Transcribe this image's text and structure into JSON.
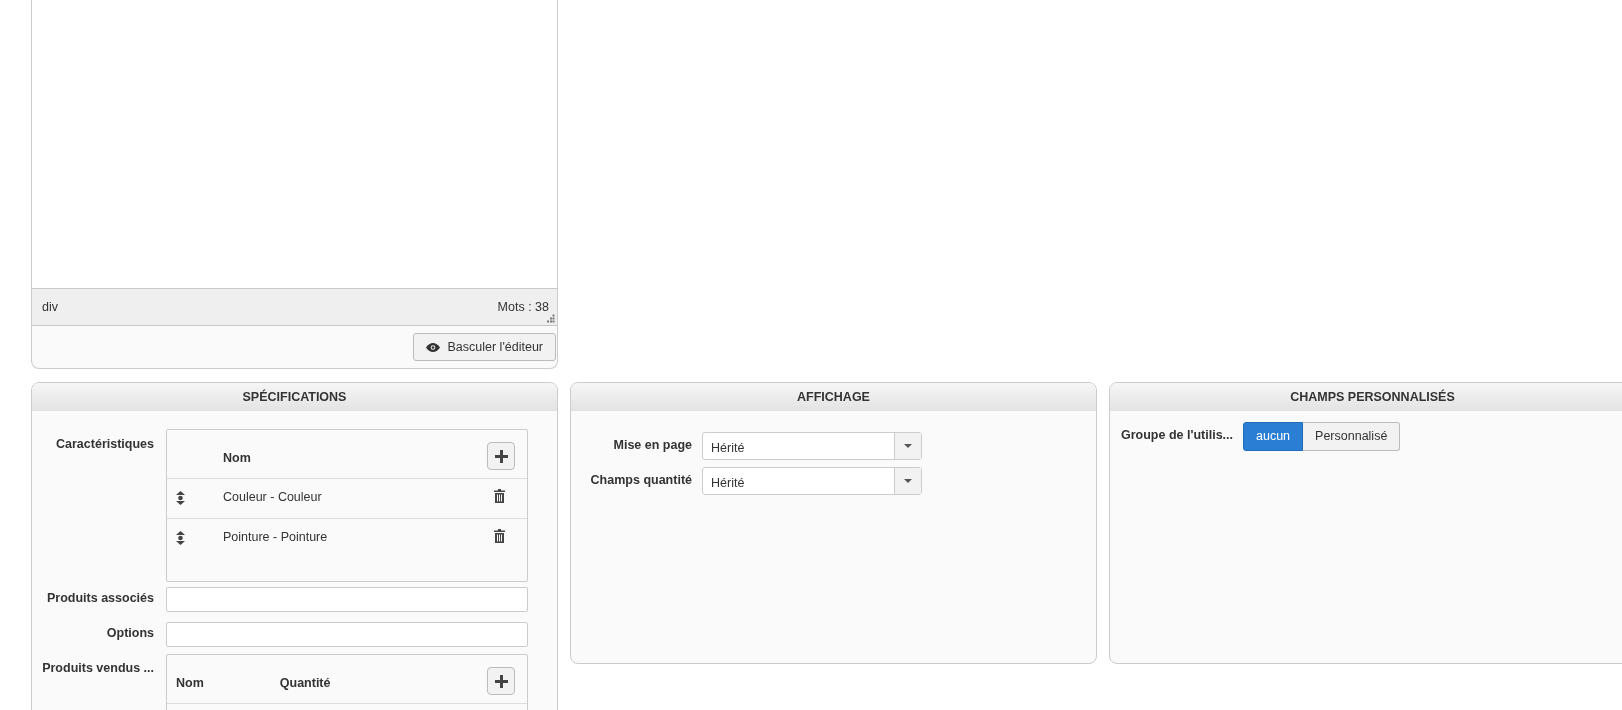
{
  "editor": {
    "path": "div",
    "word_count": "Mots : 38",
    "toggle_button": "Basculer l'éditeur"
  },
  "specifications": {
    "title": "SPÉCIFICATIONS",
    "characteristics": {
      "label": "Caractéristiques",
      "columns": [
        "Nom"
      ],
      "rows": [
        {
          "name": "Couleur - Couleur"
        },
        {
          "name": "Pointure - Pointure"
        }
      ]
    },
    "related_products": {
      "label": "Produits associés"
    },
    "options": {
      "label": "Options"
    },
    "sold_with": {
      "label": "Produits vendus ...",
      "columns": [
        "Nom",
        "Quantité"
      ]
    }
  },
  "display": {
    "title": "AFFICHAGE",
    "fields": [
      {
        "label": "Mise en page",
        "value": "Hérité"
      },
      {
        "label": "Champs quantité",
        "value": "Hérité"
      }
    ]
  },
  "custom_fields": {
    "title": "CHAMPS PERSONNALISÉS",
    "fields": [
      {
        "label": "Groupe de l'utilis...",
        "options": [
          {
            "label": "aucun",
            "selected": true
          },
          {
            "label": "Personnalisé",
            "selected": false
          }
        ]
      }
    ]
  }
}
